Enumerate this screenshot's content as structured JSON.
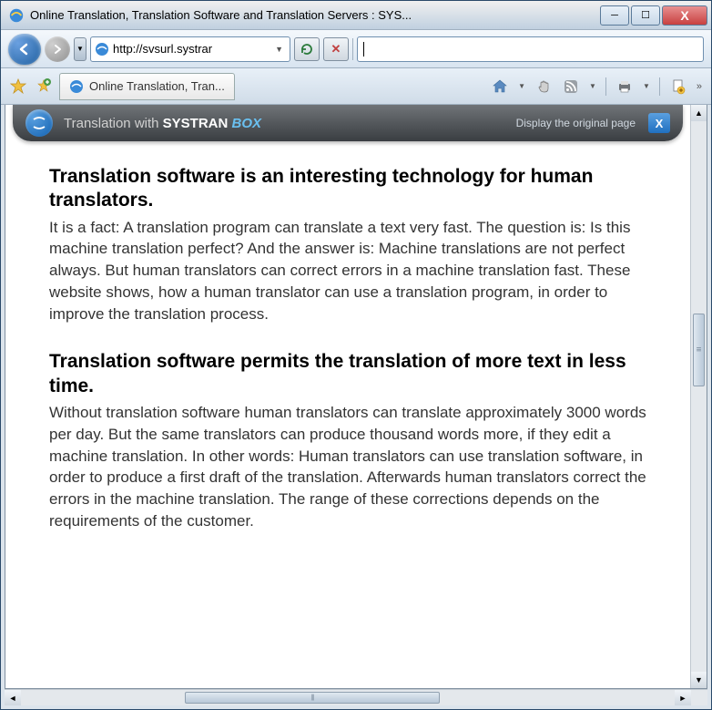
{
  "window": {
    "title": "Online Translation, Translation Software and Translation Servers : SYS..."
  },
  "nav": {
    "url": "http://svsurl.systrar"
  },
  "tab": {
    "label": "Online Translation, Tran..."
  },
  "systran": {
    "prefix": "Translation with ",
    "brand": "SYSTRAN",
    "box": "BOX",
    "display_link": "Display the original page"
  },
  "article": {
    "h1": "Translation software is an interesting technology for human translators.",
    "p1": "It is a fact: A translation program can translate a text very fast. The question is: Is this machine translation perfect? And the answer is: Machine translations are not perfect always. But human translators can correct errors in a machine translation fast. These website shows, how a human translator can use a translation program, in order to improve the translation process.",
    "h2": "Translation software permits the translation of more text in less time.",
    "p2": "Without translation software human translators can translate approximately 3000 words per day. But the same translators can produce thousand words more, if they edit a machine translation. In other words: Human translators can use translation software, in order to produce a first draft of the translation. Afterwards human translators correct the errors in the machine translation. The range of these corrections depends on the requirements of the customer."
  }
}
